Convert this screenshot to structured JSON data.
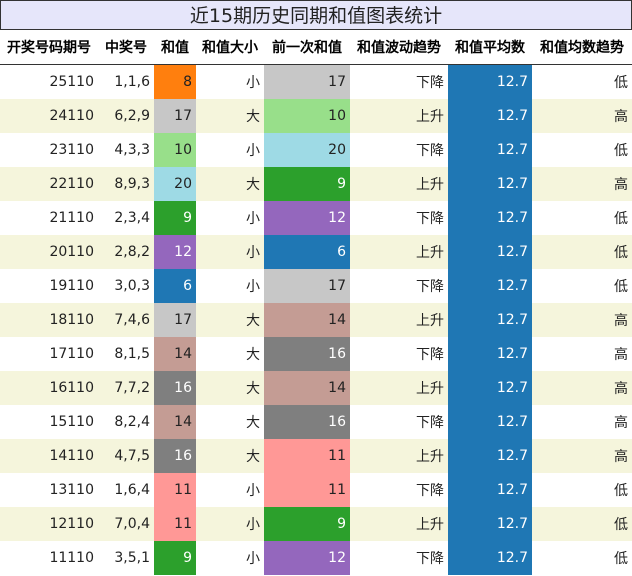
{
  "title": "近15期历史同期和值图表统计",
  "columns": [
    "开奖号码期号",
    "中奖号",
    "和值",
    "和值大小",
    "前一次和值",
    "和值波动趋势",
    "和值平均数",
    "和值均数趋势"
  ],
  "colors": {
    "6": "#1f77b4",
    "8": "#ff7f0e",
    "9": "#2ca02c",
    "10": "#98df8a",
    "11": "#ff9896",
    "12": "#9467bd",
    "14": "#c49c94",
    "16": "#7f7f7f",
    "17": "#c7c7c7",
    "20": "#9edae5",
    "light_text": "#222222",
    "dark_text": "#ffffff",
    "avg_bg": "#1f77b4",
    "title_bg": "#e6e6fa",
    "row_alt_bg": "#f5f5dc"
  },
  "rows": [
    {
      "issue": "25110",
      "numbers": "1,1,6",
      "sum": "8",
      "size": "小",
      "prev_sum": "17",
      "trend": "下降",
      "avg": "12.7",
      "avg_trend": "低"
    },
    {
      "issue": "24110",
      "numbers": "6,2,9",
      "sum": "17",
      "size": "大",
      "prev_sum": "10",
      "trend": "上升",
      "avg": "12.7",
      "avg_trend": "高"
    },
    {
      "issue": "23110",
      "numbers": "4,3,3",
      "sum": "10",
      "size": "小",
      "prev_sum": "20",
      "trend": "下降",
      "avg": "12.7",
      "avg_trend": "低"
    },
    {
      "issue": "22110",
      "numbers": "8,9,3",
      "sum": "20",
      "size": "大",
      "prev_sum": "9",
      "trend": "上升",
      "avg": "12.7",
      "avg_trend": "高"
    },
    {
      "issue": "21110",
      "numbers": "2,3,4",
      "sum": "9",
      "size": "小",
      "prev_sum": "12",
      "trend": "下降",
      "avg": "12.7",
      "avg_trend": "低"
    },
    {
      "issue": "20110",
      "numbers": "2,8,2",
      "sum": "12",
      "size": "小",
      "prev_sum": "6",
      "trend": "上升",
      "avg": "12.7",
      "avg_trend": "低"
    },
    {
      "issue": "19110",
      "numbers": "3,0,3",
      "sum": "6",
      "size": "小",
      "prev_sum": "17",
      "trend": "下降",
      "avg": "12.7",
      "avg_trend": "低"
    },
    {
      "issue": "18110",
      "numbers": "7,4,6",
      "sum": "17",
      "size": "大",
      "prev_sum": "14",
      "trend": "上升",
      "avg": "12.7",
      "avg_trend": "高"
    },
    {
      "issue": "17110",
      "numbers": "8,1,5",
      "sum": "14",
      "size": "大",
      "prev_sum": "16",
      "trend": "下降",
      "avg": "12.7",
      "avg_trend": "高"
    },
    {
      "issue": "16110",
      "numbers": "7,7,2",
      "sum": "16",
      "size": "大",
      "prev_sum": "14",
      "trend": "上升",
      "avg": "12.7",
      "avg_trend": "高"
    },
    {
      "issue": "15110",
      "numbers": "8,2,4",
      "sum": "14",
      "size": "大",
      "prev_sum": "16",
      "trend": "下降",
      "avg": "12.7",
      "avg_trend": "高"
    },
    {
      "issue": "14110",
      "numbers": "4,7,5",
      "sum": "16",
      "size": "大",
      "prev_sum": "11",
      "trend": "上升",
      "avg": "12.7",
      "avg_trend": "高"
    },
    {
      "issue": "13110",
      "numbers": "1,6,4",
      "sum": "11",
      "size": "小",
      "prev_sum": "11",
      "trend": "下降",
      "avg": "12.7",
      "avg_trend": "低"
    },
    {
      "issue": "12110",
      "numbers": "7,0,4",
      "sum": "11",
      "size": "小",
      "prev_sum": "9",
      "trend": "上升",
      "avg": "12.7",
      "avg_trend": "低"
    },
    {
      "issue": "11110",
      "numbers": "3,5,1",
      "sum": "9",
      "size": "小",
      "prev_sum": "12",
      "trend": "下降",
      "avg": "12.7",
      "avg_trend": "低"
    }
  ]
}
